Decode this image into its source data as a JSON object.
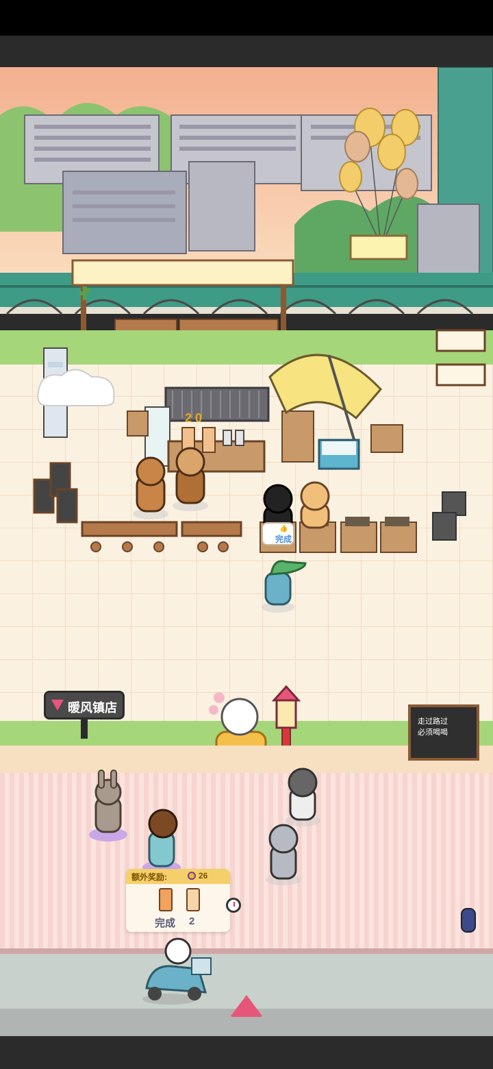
{
  "store_sign": {
    "name": "暖风镇店"
  },
  "counter_display": {
    "digits": "2 0"
  },
  "order_bubble": {
    "status": "完成"
  },
  "chalkboard": {
    "line1": "走过路过",
    "line2": "必须喝喝"
  },
  "bonus_panel": {
    "label": "额外奖励:",
    "coin_amount": "26",
    "status": "完成",
    "count": "2"
  },
  "icons": {
    "sign_icon": "wifi-signal-icon",
    "bubble_icon": "thumbs-up-icon",
    "coin_icon": "coin-icon",
    "timer_icon": "clock-icon",
    "expand_icon": "up-arrow-icon"
  },
  "colors": {
    "sky": "#f6c9a4",
    "grass": "#a6d67a",
    "floor": "#fbf1e1",
    "accent_pink": "#e8557a",
    "coin": "#e9b92f"
  }
}
